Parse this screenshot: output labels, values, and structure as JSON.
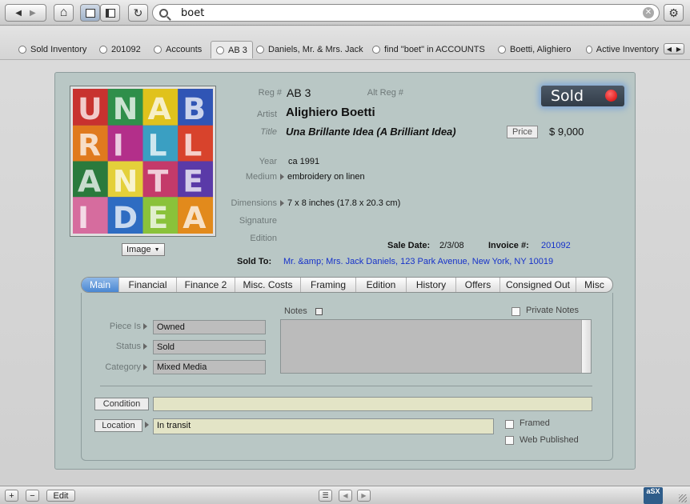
{
  "toolbar": {
    "back_glyph": "◀",
    "forward_glyph": "▶",
    "home_glyph": "⌂",
    "reload_glyph": "↻",
    "search_value": "boet",
    "clear_glyph": "✕",
    "settings_glyph": "⚙"
  },
  "window_tabs": [
    {
      "label": "Sold Inventory"
    },
    {
      "label": "201092"
    },
    {
      "label": "Accounts"
    },
    {
      "label": "AB 3"
    },
    {
      "label": "Daniels, Mr. & Mrs. Jack"
    },
    {
      "label": "find \"boet\" in ACCOUNTS"
    },
    {
      "label": "Boetti, Alighiero"
    },
    {
      "label": "Active Inventory"
    }
  ],
  "record": {
    "reg_label": "Reg #",
    "reg_value": "AB 3",
    "alt_reg_label": "Alt Reg #",
    "artist_label": "Artist",
    "artist_value": "Alighiero Boetti",
    "title_label": "Title",
    "title_value": "Una Brillante Idea (A Brilliant Idea)",
    "price_button": "Price",
    "price_value": "$ 9,000",
    "status_badge": "Sold",
    "year_label": "Year",
    "year_value": "ca 1991",
    "medium_label": "Medium",
    "medium_value": "embroidery on linen",
    "dimensions_label": "Dimensions",
    "dimensions_value": "7 x 8 inches  (17.8 x 20.3 cm)",
    "signature_label": "Signature",
    "edition_label": "Edition",
    "sale_date_label": "Sale Date:",
    "sale_date_value": "2/3/08",
    "invoice_label": "Invoice #:",
    "invoice_value": "201092",
    "sold_to_label": "Sold To:",
    "sold_to_value": "Mr. &amp; Mrs. Jack Daniels, 123 Park Avenue, New York, NY 10019",
    "image_button": "Image"
  },
  "tabs": [
    {
      "label": "Main"
    },
    {
      "label": "Financial"
    },
    {
      "label": "Finance 2"
    },
    {
      "label": "Misc. Costs"
    },
    {
      "label": "Framing"
    },
    {
      "label": "Edition"
    },
    {
      "label": "History"
    },
    {
      "label": "Offers"
    },
    {
      "label": "Consigned Out"
    },
    {
      "label": "Misc"
    }
  ],
  "main_tab": {
    "piece_is_label": "Piece Is",
    "piece_is_value": "Owned",
    "status_label": "Status",
    "status_value": "Sold",
    "category_label": "Category",
    "category_value": "Mixed Media",
    "notes_label": "Notes",
    "notes_value": "",
    "private_notes_label": "Private Notes",
    "condition_button": "Condition",
    "condition_value": "",
    "location_button": "Location",
    "location_value": "In transit",
    "framed_label": "Framed",
    "web_published_label": "Web Published"
  },
  "bottom": {
    "add_glyph": "+",
    "remove_glyph": "−",
    "edit_label": "Edit",
    "logo_text": "aSX"
  }
}
